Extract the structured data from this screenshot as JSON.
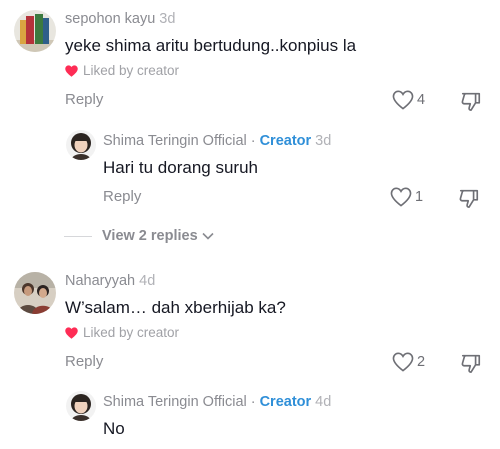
{
  "comments": [
    {
      "username": "sepohon kayu",
      "time": "3d",
      "text": "yeke shima aritu bertudung..konpius la",
      "liked_by": "Liked by creator",
      "reply_label": "Reply",
      "likes": "4",
      "reply": {
        "username": "Shima Teringin Official",
        "creator_badge": "Creator",
        "time": "3d",
        "text": "Hari tu dorang suruh",
        "reply_label": "Reply",
        "likes": "1"
      },
      "view_replies": "View 2 replies"
    },
    {
      "username": "Naharyyah",
      "time": "4d",
      "text": "W’salam… dah xberhijab ka?",
      "liked_by": "Liked by creator",
      "reply_label": "Reply",
      "likes": "2",
      "reply": {
        "username": "Shima Teringin Official",
        "creator_badge": "Creator",
        "time": "4d",
        "text": "No"
      }
    }
  ],
  "colors": {
    "creator_accent": "#2f8fd8",
    "heart": "#fe2c55",
    "muted_text": "#8a8b91"
  }
}
